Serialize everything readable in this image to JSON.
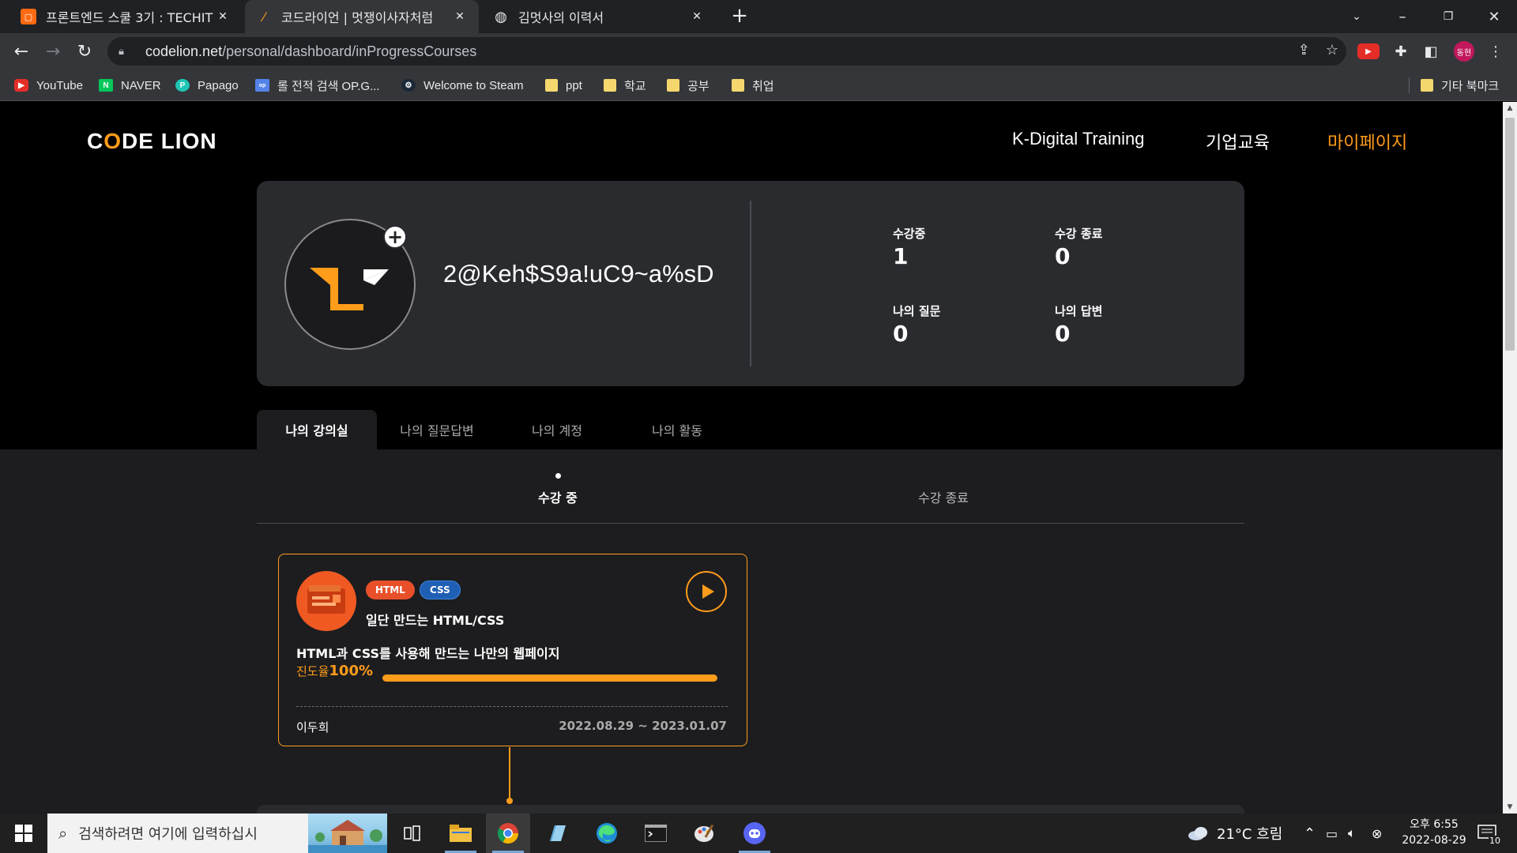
{
  "browser": {
    "tabs": [
      {
        "title": "프론트엔드 스쿨 3기 : TECHIT",
        "active": false,
        "close": "✕"
      },
      {
        "title": "코드라이언 | 멋쟁이사자처럼",
        "active": true,
        "close": "✕"
      },
      {
        "title": "김멋사의 이력서",
        "active": false,
        "close": "✕"
      }
    ],
    "new_tab": "+",
    "url_host": "codelion.net",
    "url_path": "/personal/dashboard/inProgressCourses",
    "profile_badge": "동현",
    "bookmarks": [
      {
        "label": "YouTube",
        "icon": "youtube-icon"
      },
      {
        "label": "NAVER",
        "icon": "naver-icon"
      },
      {
        "label": "Papago",
        "icon": "papago-icon"
      },
      {
        "label": "롤 전적 검색 OP.G...",
        "icon": "opgg-icon"
      },
      {
        "label": "Welcome to Steam",
        "icon": "steam-icon"
      },
      {
        "label": "ppt",
        "icon": "folder-icon"
      },
      {
        "label": "학교",
        "icon": "folder-icon"
      },
      {
        "label": "공부",
        "icon": "folder-icon"
      },
      {
        "label": "취업",
        "icon": "folder-icon"
      }
    ],
    "other_bookmarks": "기타 북마크"
  },
  "site": {
    "logo": {
      "prefix": "C",
      "slash": "O",
      "rest": "DE LION"
    },
    "nav": [
      {
        "label": "K-Digital Training",
        "active": false
      },
      {
        "label": "기업교육",
        "active": false
      },
      {
        "label": "마이페이지",
        "active": true
      }
    ],
    "accent_color": "#ff9c1a"
  },
  "profile": {
    "username": "2@Keh$S9a!uC9~a%sD",
    "stats": [
      {
        "label": "수강중",
        "value": "1"
      },
      {
        "label": "수강 종료",
        "value": "0"
      },
      {
        "label": "나의 질문",
        "value": "0"
      },
      {
        "label": "나의 답변",
        "value": "0"
      }
    ]
  },
  "my_tabs": [
    {
      "label": "나의 강의실",
      "active": true
    },
    {
      "label": "나의 질문답변",
      "active": false
    },
    {
      "label": "나의 계정",
      "active": false
    },
    {
      "label": "나의 활동",
      "active": false
    }
  ],
  "sub_tabs": [
    {
      "label": "수강 중",
      "active": true
    },
    {
      "label": "수강 종료",
      "active": false
    }
  ],
  "course": {
    "tags": [
      {
        "label": "HTML",
        "color": "#e8502a"
      },
      {
        "label": "CSS",
        "color": "#1f5fb4"
      }
    ],
    "title": "일단 만드는 HTML/CSS",
    "description": "HTML과 CSS를 사용해 만드는 나만의 웹페이지",
    "progress_label": "진도율",
    "progress_text": "100%",
    "progress": 1.0,
    "instructor": "이두희",
    "period": "2022.08.29 ~ 2023.01.07"
  },
  "taskbar": {
    "search_placeholder": "검색하려면 여기에 입력하십시",
    "weather": "21°C  흐림",
    "time": "오후 6:55",
    "date": "2022-08-29",
    "notifications": "10"
  }
}
